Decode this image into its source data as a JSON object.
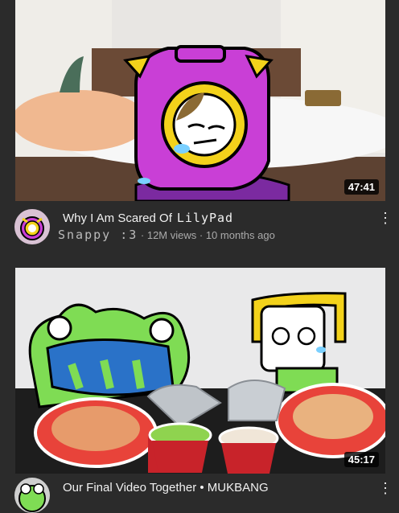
{
  "videos": [
    {
      "title_prefix": "Why I Am Scared Of",
      "title_handwritten": "LilyPad",
      "channel": "Snappy :3",
      "views": "· 12M views",
      "age": "· 10 months ago",
      "duration": "47:41",
      "menu_icon": "more-vert-icon"
    },
    {
      "title": "Our Final Video Together • MUKBANG",
      "duration": "45:17",
      "menu_icon": "more-vert-icon"
    }
  ],
  "colors": {
    "background": "#2b2b2b",
    "text": "#f1f1f1",
    "meta_text": "#aaaaaa",
    "character_purple": "#c93fd6",
    "character_yellow": "#f3d21b",
    "frog_green": "#7fdc54"
  }
}
